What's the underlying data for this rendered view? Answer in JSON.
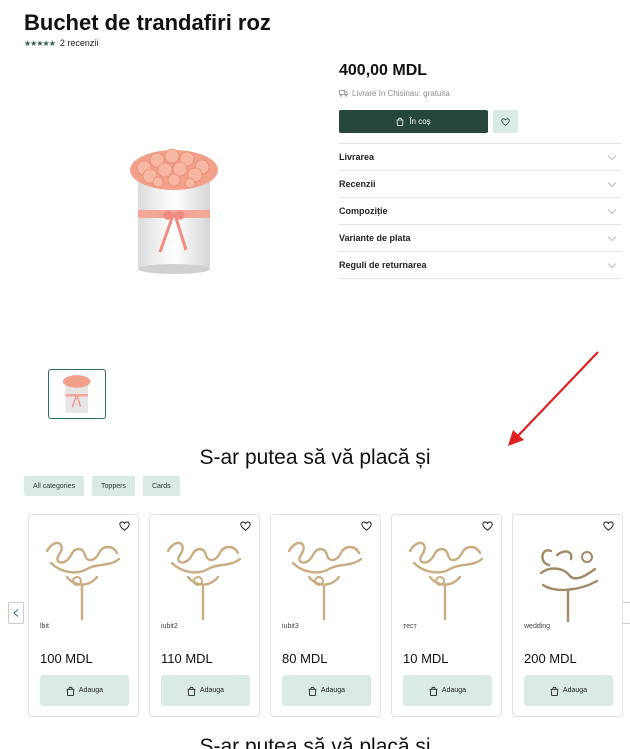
{
  "product": {
    "title": "Buchet de trandafiri roz",
    "rating_stars": "★★★★★",
    "reviews": "2 recenzii",
    "price": "400,00 MDL",
    "delivery_note": "Livrare în Chisinau: gratuita",
    "add_to_cart_label": "În coș"
  },
  "accordion": [
    {
      "label": "Livrarea"
    },
    {
      "label": "Recenzii"
    },
    {
      "label": "Compoziție"
    },
    {
      "label": "Variante de plata"
    },
    {
      "label": "Reguli de returnarea"
    }
  ],
  "related": {
    "title": "S-ar putea să vă placă și",
    "filters": [
      "All categories",
      "Toppers",
      "Cards"
    ],
    "items": [
      {
        "name": "lbit",
        "price": "100 MDL",
        "add_label": "Adauga",
        "image": "cake-topper-lubimaya-icon"
      },
      {
        "name": "iubit2",
        "price": "110 MDL",
        "add_label": "Adauga",
        "image": "cake-topper-lubimaya-icon"
      },
      {
        "name": "iubit3",
        "price": "80 MDL",
        "add_label": "Adauga",
        "image": "cake-topper-lubimaya-icon"
      },
      {
        "name": "тест",
        "price": "10 MDL",
        "add_label": "Adauga",
        "image": "cake-topper-lubimaya-icon"
      },
      {
        "name": "wedding",
        "price": "200 MDL",
        "add_label": "Adauga",
        "image": "cake-topper-wedding-icon"
      }
    ]
  },
  "second_section": {
    "title": "S-ar putea să vă placă și"
  },
  "colors": {
    "accent_dark": "#27473c",
    "accent_light": "#d9ebe3",
    "topper_gold": "#c9ad82",
    "arrow_red": "#e02020"
  }
}
